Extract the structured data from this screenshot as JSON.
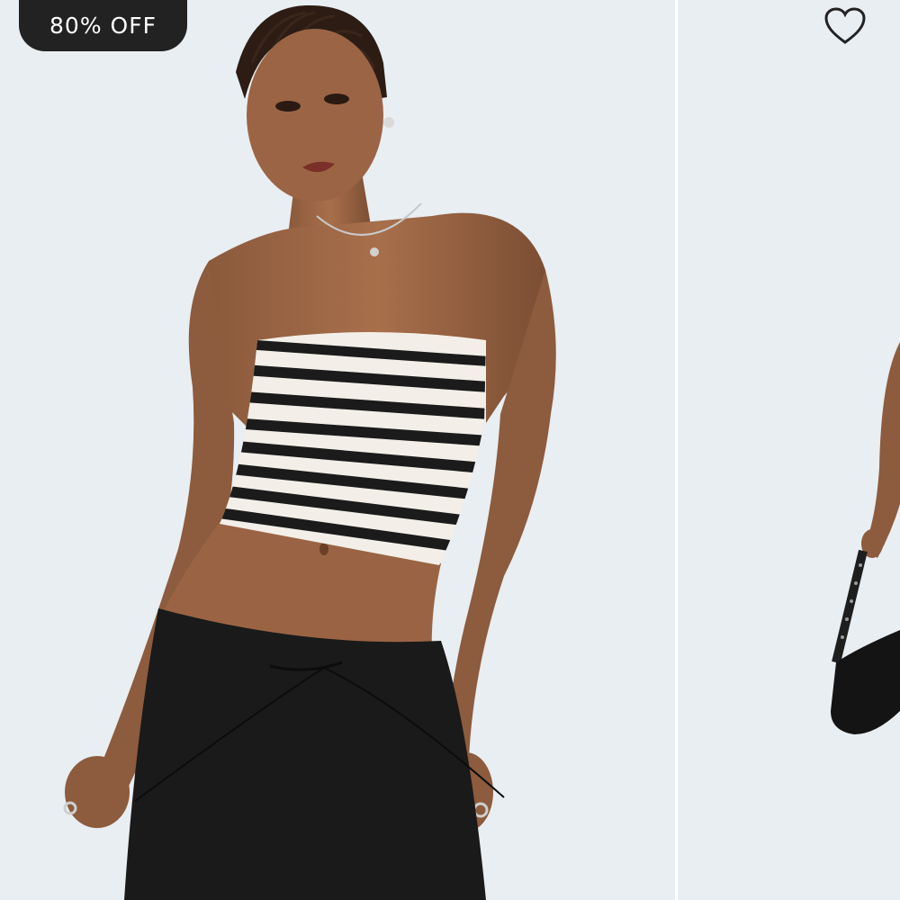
{
  "badge": {
    "discount_label": "80% OFF"
  },
  "favorite": {
    "icon": "heart-outline-icon"
  },
  "gallery": {
    "current_image": "model-striped-tube-top-photo",
    "next_image": "model-black-shoulder-bag-photo"
  },
  "colors": {
    "background": "#e8eef2",
    "badge_bg": "#222222",
    "badge_text": "#ffffff",
    "top_stripe": "#1b1b1b",
    "top_base": "#f3efe8"
  }
}
